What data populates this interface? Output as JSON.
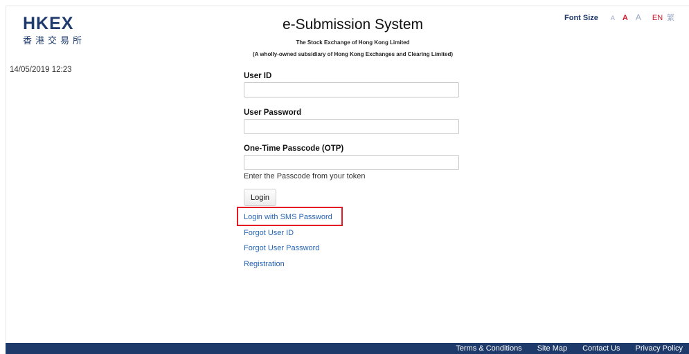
{
  "brand": {
    "logo_text": "HKEX",
    "logo_cn": "香港交易所"
  },
  "datetime": "14/05/2019 12:23",
  "font_size": {
    "label": "Font Size",
    "options": [
      "A",
      "A",
      "A"
    ],
    "lang_en": "EN",
    "lang_tc": "繁"
  },
  "header": {
    "title": "e-Submission System",
    "subtitle": "The Stock Exchange of Hong Kong Limited",
    "subtitle2": "(A wholly-owned subsidiary of Hong Kong Exchanges and Clearing Limited)"
  },
  "form": {
    "user_id_label": "User ID",
    "user_id_value": "",
    "password_label": "User Password",
    "password_value": "",
    "otp_label": "One-Time Passcode (OTP)",
    "otp_value": "",
    "otp_hint": "Enter the Passcode from your token",
    "login_button": "Login"
  },
  "links": {
    "sms_login": "Login with SMS Password",
    "forgot_id": "Forgot User ID",
    "forgot_password": "Forgot User Password",
    "registration": "Registration"
  },
  "footer": {
    "links": [
      "Terms & Conditions",
      "Site Map",
      "Contact Us",
      "Privacy Policy"
    ]
  },
  "colors": {
    "brand_navy": "#1f3b6e",
    "link_blue": "#2463b4",
    "accent_red": "#d11c2c",
    "footer_bg": "#1d3a6b",
    "highlight_red": "#e21b25"
  }
}
